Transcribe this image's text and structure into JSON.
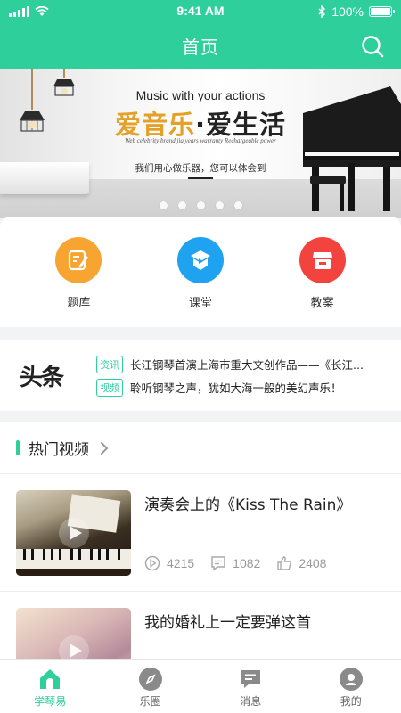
{
  "status_bar": {
    "time": "9:41 AM",
    "battery": "100%"
  },
  "header": {
    "title": "首页"
  },
  "banner": {
    "english_tagline": "Music with your actions",
    "slogan_left": "爱音乐",
    "slogan_dot": "·",
    "slogan_right": "爱生活",
    "small_english": "Web celebrity brand jia years warranty Rechargeable power",
    "chinese_caption": "我们用心做乐器，您可以体会到",
    "slide_count": 5
  },
  "quick_entries": [
    {
      "label": "题库",
      "color": "#f7a431",
      "icon": "edit-icon"
    },
    {
      "label": "课堂",
      "color": "#1fa2f0",
      "icon": "classroom-icon"
    },
    {
      "label": "教案",
      "color": "#f2433f",
      "icon": "shop-icon"
    }
  ],
  "headlines": {
    "logo": "头条",
    "items": [
      {
        "tag": "资讯",
        "text": "长江钢琴首演上海市重大文创作品——《长江..."
      },
      {
        "tag": "视频",
        "text": "聆听钢琴之声，犹如大海一般的美幻声乐！"
      }
    ]
  },
  "hot_videos": {
    "title": "热门视频",
    "items": [
      {
        "title": "演奏会上的《Kiss The Rain》",
        "plays": "4215",
        "comments": "1082",
        "likes": "2408"
      },
      {
        "title": "我的婚礼上一定要弹这首"
      }
    ]
  },
  "tabs": [
    {
      "label": "学琴易",
      "icon": "home-icon",
      "active": true
    },
    {
      "label": "乐圈",
      "icon": "compass-icon",
      "active": false
    },
    {
      "label": "消息",
      "icon": "message-icon",
      "active": false
    },
    {
      "label": "我的",
      "icon": "profile-icon",
      "active": false
    }
  ],
  "colors": {
    "accent": "#2fcf9b",
    "orange": "#f7a431",
    "blue": "#1fa2f0",
    "red": "#f2433f"
  }
}
